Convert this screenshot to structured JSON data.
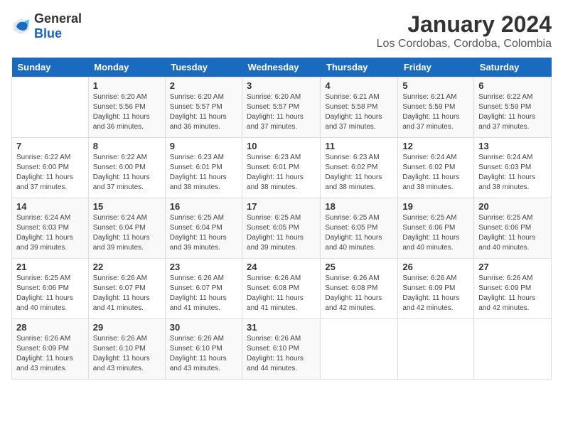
{
  "header": {
    "logo_general": "General",
    "logo_blue": "Blue",
    "month_year": "January 2024",
    "location": "Los Cordobas, Cordoba, Colombia"
  },
  "days_of_week": [
    "Sunday",
    "Monday",
    "Tuesday",
    "Wednesday",
    "Thursday",
    "Friday",
    "Saturday"
  ],
  "weeks": [
    [
      {
        "day": "",
        "info": ""
      },
      {
        "day": "1",
        "info": "Sunrise: 6:20 AM\nSunset: 5:56 PM\nDaylight: 11 hours\nand 36 minutes."
      },
      {
        "day": "2",
        "info": "Sunrise: 6:20 AM\nSunset: 5:57 PM\nDaylight: 11 hours\nand 36 minutes."
      },
      {
        "day": "3",
        "info": "Sunrise: 6:20 AM\nSunset: 5:57 PM\nDaylight: 11 hours\nand 37 minutes."
      },
      {
        "day": "4",
        "info": "Sunrise: 6:21 AM\nSunset: 5:58 PM\nDaylight: 11 hours\nand 37 minutes."
      },
      {
        "day": "5",
        "info": "Sunrise: 6:21 AM\nSunset: 5:59 PM\nDaylight: 11 hours\nand 37 minutes."
      },
      {
        "day": "6",
        "info": "Sunrise: 6:22 AM\nSunset: 5:59 PM\nDaylight: 11 hours\nand 37 minutes."
      }
    ],
    [
      {
        "day": "7",
        "info": "Sunrise: 6:22 AM\nSunset: 6:00 PM\nDaylight: 11 hours\nand 37 minutes."
      },
      {
        "day": "8",
        "info": "Sunrise: 6:22 AM\nSunset: 6:00 PM\nDaylight: 11 hours\nand 37 minutes."
      },
      {
        "day": "9",
        "info": "Sunrise: 6:23 AM\nSunset: 6:01 PM\nDaylight: 11 hours\nand 38 minutes."
      },
      {
        "day": "10",
        "info": "Sunrise: 6:23 AM\nSunset: 6:01 PM\nDaylight: 11 hours\nand 38 minutes."
      },
      {
        "day": "11",
        "info": "Sunrise: 6:23 AM\nSunset: 6:02 PM\nDaylight: 11 hours\nand 38 minutes."
      },
      {
        "day": "12",
        "info": "Sunrise: 6:24 AM\nSunset: 6:02 PM\nDaylight: 11 hours\nand 38 minutes."
      },
      {
        "day": "13",
        "info": "Sunrise: 6:24 AM\nSunset: 6:03 PM\nDaylight: 11 hours\nand 38 minutes."
      }
    ],
    [
      {
        "day": "14",
        "info": "Sunrise: 6:24 AM\nSunset: 6:03 PM\nDaylight: 11 hours\nand 39 minutes."
      },
      {
        "day": "15",
        "info": "Sunrise: 6:24 AM\nSunset: 6:04 PM\nDaylight: 11 hours\nand 39 minutes."
      },
      {
        "day": "16",
        "info": "Sunrise: 6:25 AM\nSunset: 6:04 PM\nDaylight: 11 hours\nand 39 minutes."
      },
      {
        "day": "17",
        "info": "Sunrise: 6:25 AM\nSunset: 6:05 PM\nDaylight: 11 hours\nand 39 minutes."
      },
      {
        "day": "18",
        "info": "Sunrise: 6:25 AM\nSunset: 6:05 PM\nDaylight: 11 hours\nand 40 minutes."
      },
      {
        "day": "19",
        "info": "Sunrise: 6:25 AM\nSunset: 6:06 PM\nDaylight: 11 hours\nand 40 minutes."
      },
      {
        "day": "20",
        "info": "Sunrise: 6:25 AM\nSunset: 6:06 PM\nDaylight: 11 hours\nand 40 minutes."
      }
    ],
    [
      {
        "day": "21",
        "info": "Sunrise: 6:25 AM\nSunset: 6:06 PM\nDaylight: 11 hours\nand 40 minutes."
      },
      {
        "day": "22",
        "info": "Sunrise: 6:26 AM\nSunset: 6:07 PM\nDaylight: 11 hours\nand 41 minutes."
      },
      {
        "day": "23",
        "info": "Sunrise: 6:26 AM\nSunset: 6:07 PM\nDaylight: 11 hours\nand 41 minutes."
      },
      {
        "day": "24",
        "info": "Sunrise: 6:26 AM\nSunset: 6:08 PM\nDaylight: 11 hours\nand 41 minutes."
      },
      {
        "day": "25",
        "info": "Sunrise: 6:26 AM\nSunset: 6:08 PM\nDaylight: 11 hours\nand 42 minutes."
      },
      {
        "day": "26",
        "info": "Sunrise: 6:26 AM\nSunset: 6:09 PM\nDaylight: 11 hours\nand 42 minutes."
      },
      {
        "day": "27",
        "info": "Sunrise: 6:26 AM\nSunset: 6:09 PM\nDaylight: 11 hours\nand 42 minutes."
      }
    ],
    [
      {
        "day": "28",
        "info": "Sunrise: 6:26 AM\nSunset: 6:09 PM\nDaylight: 11 hours\nand 43 minutes."
      },
      {
        "day": "29",
        "info": "Sunrise: 6:26 AM\nSunset: 6:10 PM\nDaylight: 11 hours\nand 43 minutes."
      },
      {
        "day": "30",
        "info": "Sunrise: 6:26 AM\nSunset: 6:10 PM\nDaylight: 11 hours\nand 43 minutes."
      },
      {
        "day": "31",
        "info": "Sunrise: 6:26 AM\nSunset: 6:10 PM\nDaylight: 11 hours\nand 44 minutes."
      },
      {
        "day": "",
        "info": ""
      },
      {
        "day": "",
        "info": ""
      },
      {
        "day": "",
        "info": ""
      }
    ]
  ]
}
